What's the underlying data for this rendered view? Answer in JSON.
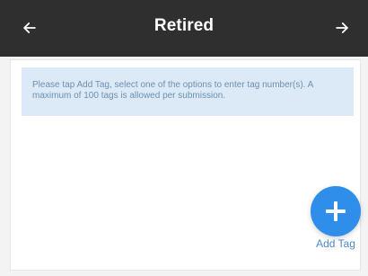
{
  "header": {
    "title": "Retired"
  },
  "info": {
    "message": "Please tap Add Tag, select one of the options to enter tag number(s). A maximum of 100 tags is allowed per submission."
  },
  "actions": {
    "add_tag_label": "Add Tag"
  },
  "icons": {
    "back": "arrow-left-icon",
    "forward": "arrow-right-icon",
    "add": "plus-icon"
  },
  "colors": {
    "header_bg": "#2f2f2f",
    "info_bg": "#dbeaf6",
    "info_text": "#6f8fb0",
    "fab_bg": "#2f8eea",
    "link": "#4f87c8"
  }
}
